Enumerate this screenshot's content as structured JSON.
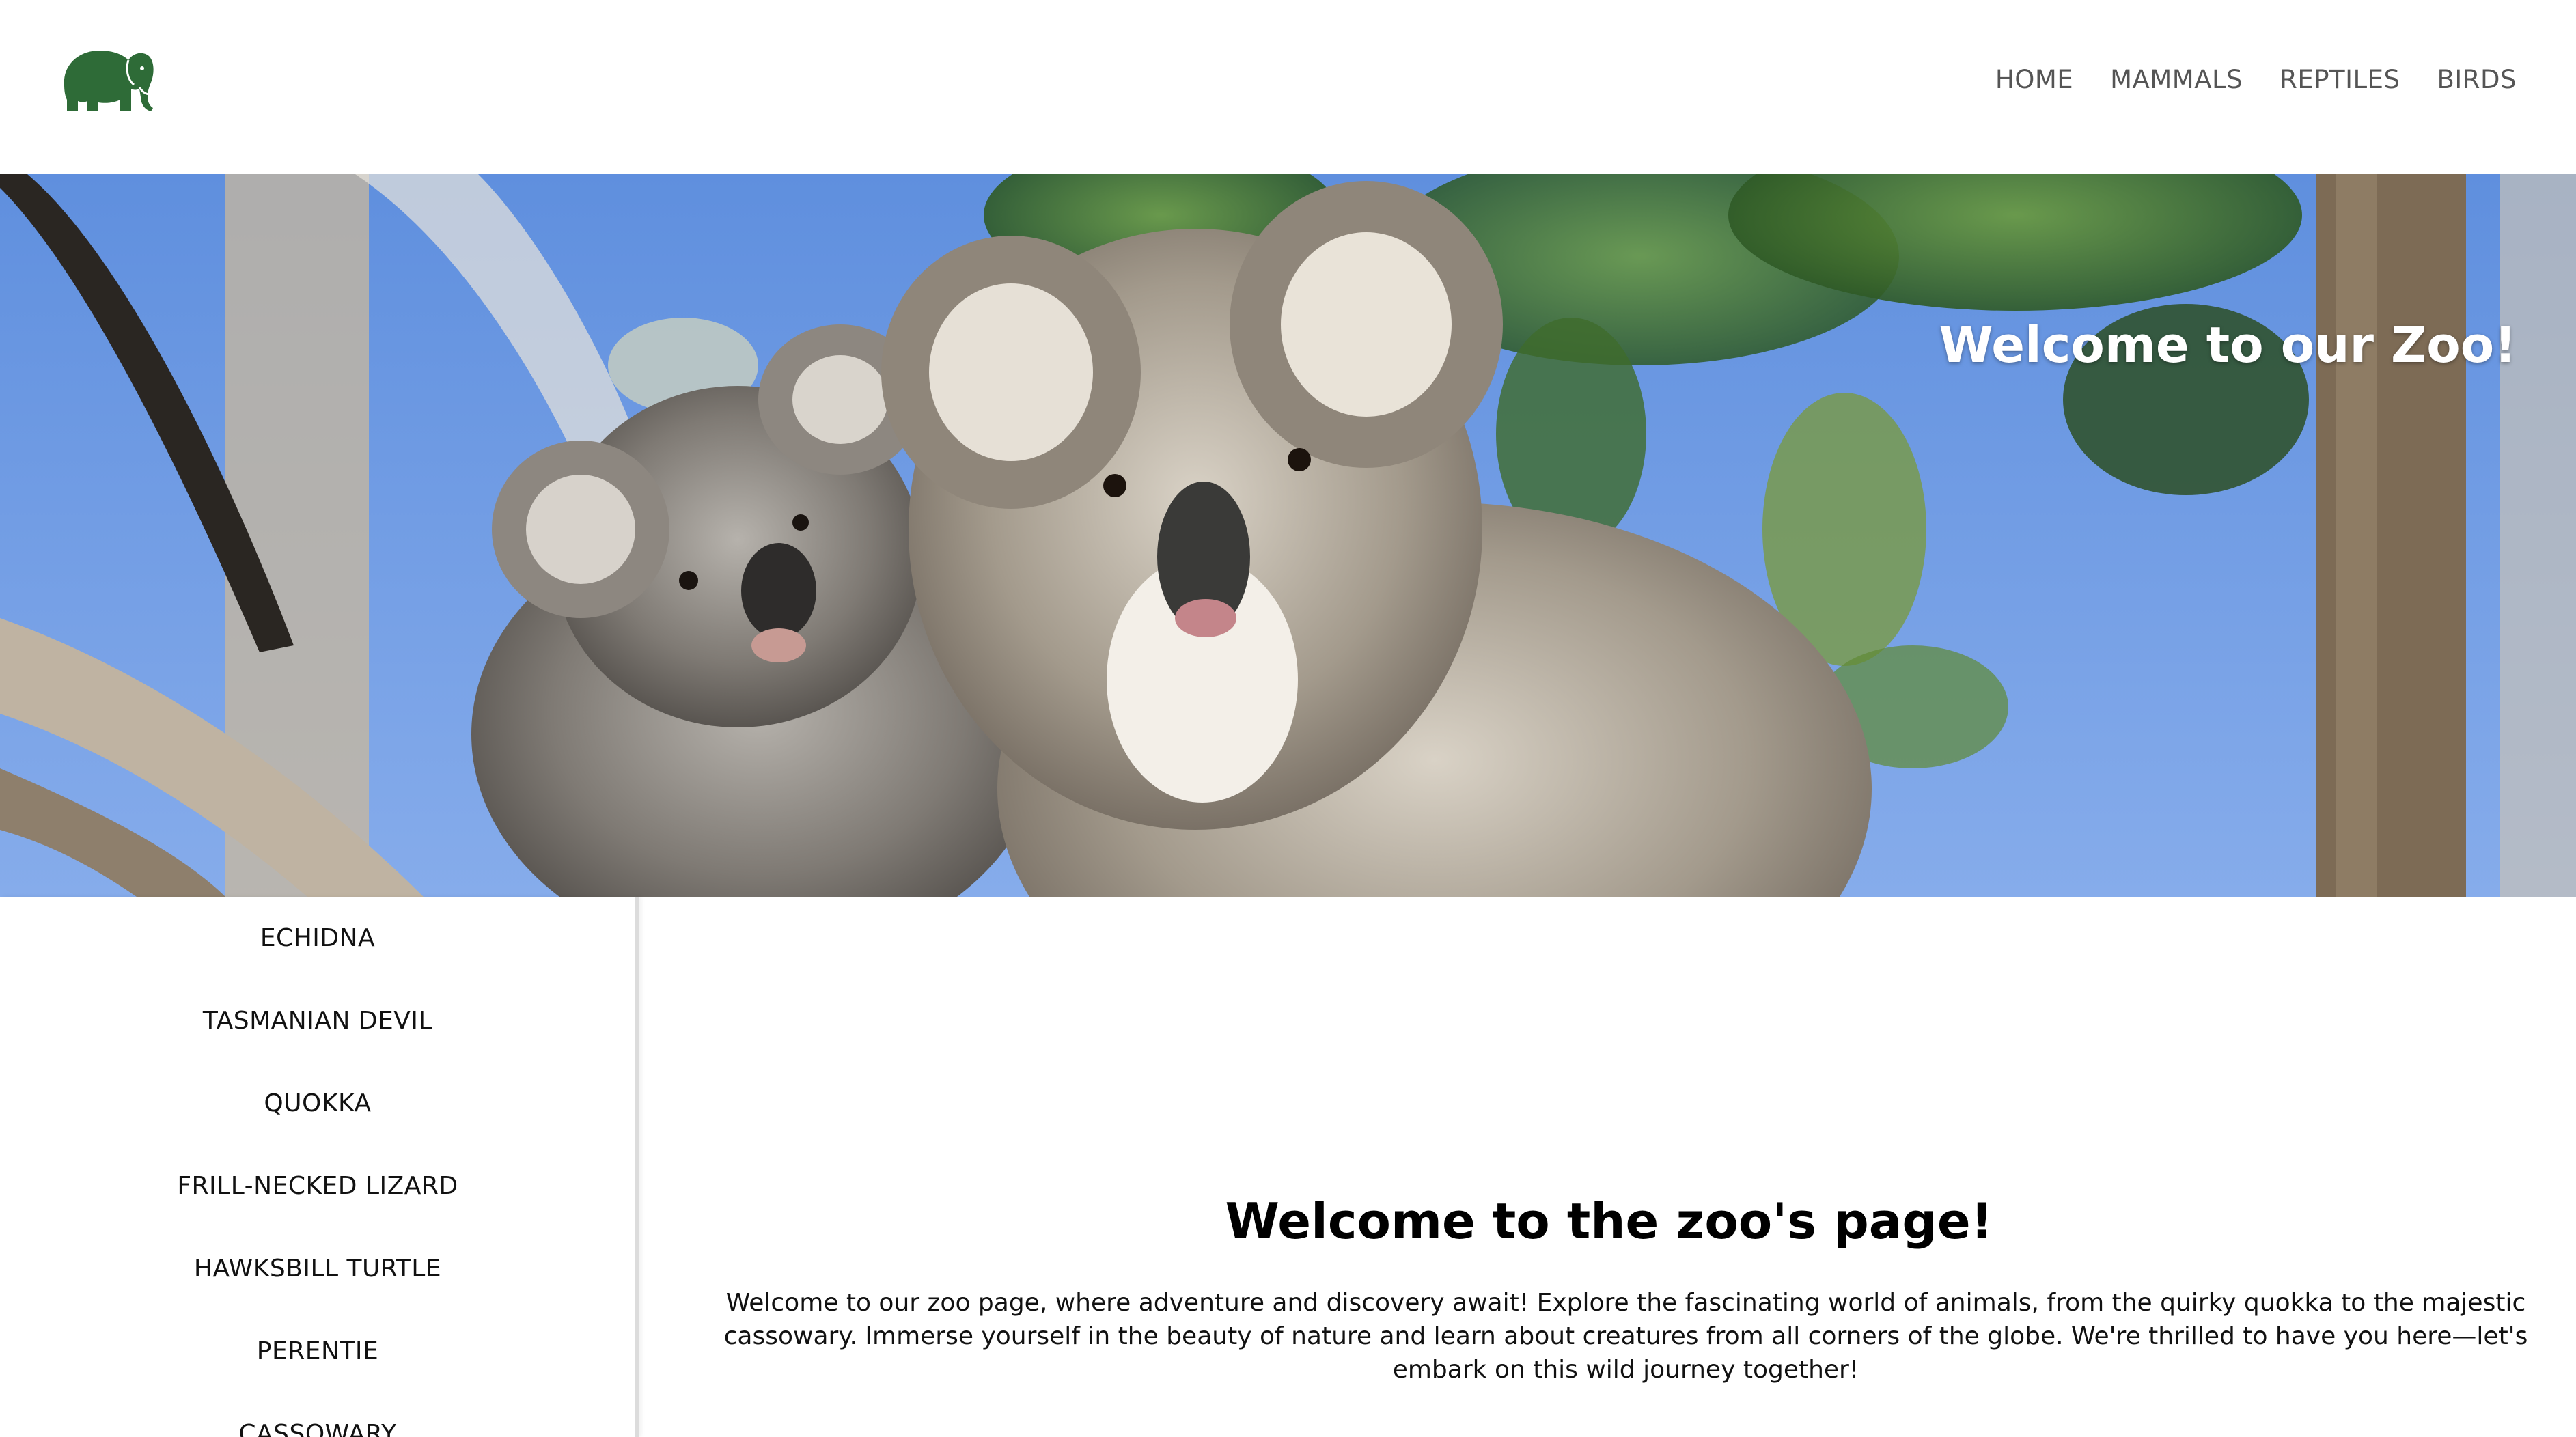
{
  "header": {
    "logo_icon": "elephant-icon",
    "logo_color": "#2e6b37",
    "nav": [
      {
        "label": "HOME"
      },
      {
        "label": "MAMMALS"
      },
      {
        "label": "REPTILES"
      },
      {
        "label": "BIRDS"
      }
    ]
  },
  "hero": {
    "title": "Welcome to our Zoo!",
    "image_subject": "koala-photo"
  },
  "sidebar": {
    "items": [
      {
        "label": "ECHIDNA"
      },
      {
        "label": "TASMANIAN DEVIL"
      },
      {
        "label": "QUOKKA"
      },
      {
        "label": "FRILL-NECKED LIZARD"
      },
      {
        "label": "HAWKSBILL TURTLE"
      },
      {
        "label": "PERENTIE"
      },
      {
        "label": "CASSOWARY"
      }
    ]
  },
  "main": {
    "heading": "Welcome to the zoo's page!",
    "paragraph": "Welcome to our zoo page, where adventure and discovery await! Explore the fascinating world of animals, from the quirky quokka to the majestic cassowary. Immerse yourself in the beauty of nature and learn about creatures from all corners of the globe. We're thrilled to have you here—let's embark on this wild journey together!"
  }
}
